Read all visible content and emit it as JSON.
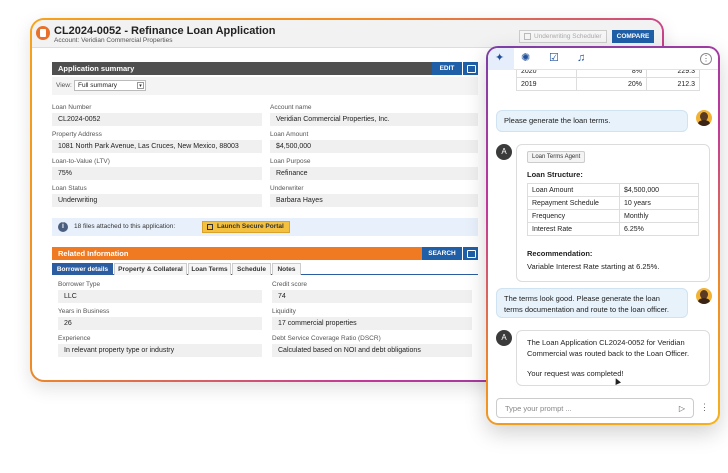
{
  "loan_window": {
    "title": "CL2024-0052 - Refinance Loan Application",
    "account": "Account: Veridian Commercial Properties",
    "underwriting_scheduler_label": "Underwriting Scheduler",
    "compare_label": "COMPARE"
  },
  "summary": {
    "header": "Application summary",
    "edit_label": "EDIT",
    "view_label": "View:",
    "view_value": "Full summary",
    "fields": {
      "loan_number": {
        "label": "Loan Number",
        "value": "CL2024-0052"
      },
      "account_name": {
        "label": "Account name",
        "value": "Veridian Commercial Properties, Inc."
      },
      "property_address": {
        "label": "Property Address",
        "value": "1081 North Park Avenue, Las Cruces, New Mexico, 88003"
      },
      "loan_amount": {
        "label": "Loan Amount",
        "value": "$4,500,000"
      },
      "ltv": {
        "label": "Loan-to-Value (LTV)",
        "value": "75%"
      },
      "loan_purpose": {
        "label": "Loan Purpose",
        "value": "Refinance"
      },
      "loan_status": {
        "label": "Loan Status",
        "value": "Underwriting"
      },
      "underwriter": {
        "label": "Underwriter",
        "value": "Barbara Hayes"
      }
    },
    "files_text": "18 files attached to this application:",
    "portal_label": "Launch Secure Portal"
  },
  "related": {
    "header": "Related Information",
    "search_label": "SEARCH",
    "tabs": [
      "Borrower details",
      "Property & Collateral",
      "Loan Terms",
      "Schedule",
      "Notes"
    ],
    "fields": {
      "borrower_type": {
        "label": "Borrower Type",
        "value": "LLC"
      },
      "credit_score": {
        "label": "Credit score",
        "value": "74"
      },
      "years_in_business": {
        "label": "Years in Business",
        "value": "26"
      },
      "liquidity": {
        "label": "Liquidity",
        "value": "17 commercial properties"
      },
      "experience": {
        "label": "Experience",
        "value": "In relevant property type or industry"
      },
      "dscr": {
        "label": "Debt Service Coverage Ratio (DSCR)",
        "value": "Calculated based on NOI and debt obligations"
      }
    }
  },
  "chat": {
    "top_table": [
      {
        "year": "2020",
        "pct": "8%",
        "val": "229.3"
      },
      {
        "year": "2019",
        "pct": "20%",
        "val": "212.3"
      }
    ],
    "msg_user_1": "Please generate the loan terms.",
    "agent_badge": "Loan Terms Agent",
    "loan_structure_title": "Loan Structure:",
    "loan_structure": [
      {
        "k": "Loan Amount",
        "v": "$4,500,000"
      },
      {
        "k": "Repayment Schedule",
        "v": "10 years"
      },
      {
        "k": "Frequency",
        "v": "Monthly"
      },
      {
        "k": "Interest Rate",
        "v": "6.25%"
      }
    ],
    "recommendation_title": "Recommendation:",
    "recommendation_text": "Variable Interest Rate starting at 6.25%.",
    "agent_initial": "A",
    "msg_user_2_line1": "The terms look good. Please generate the loan",
    "msg_user_2_line2": "terms documentation and route to the loan officer.",
    "msg_agent_2_line1": "The Loan Application CL2024-0052 for Veridian",
    "msg_agent_2_line2": "Commercial was routed back to the Loan Officer.",
    "msg_agent_2_line3": "Your request was completed!",
    "prompt_placeholder": "Type your prompt ...",
    "icons": [
      "sparkle-icon",
      "settings-icon",
      "checklist-icon",
      "bell-icon",
      "more-icon",
      "send-icon"
    ]
  },
  "colors": {
    "accent_blue": "#1f5fa8",
    "section_orange": "#f07a22",
    "section_gray": "#4f4f4f",
    "portal_yellow": "#f3c040"
  }
}
